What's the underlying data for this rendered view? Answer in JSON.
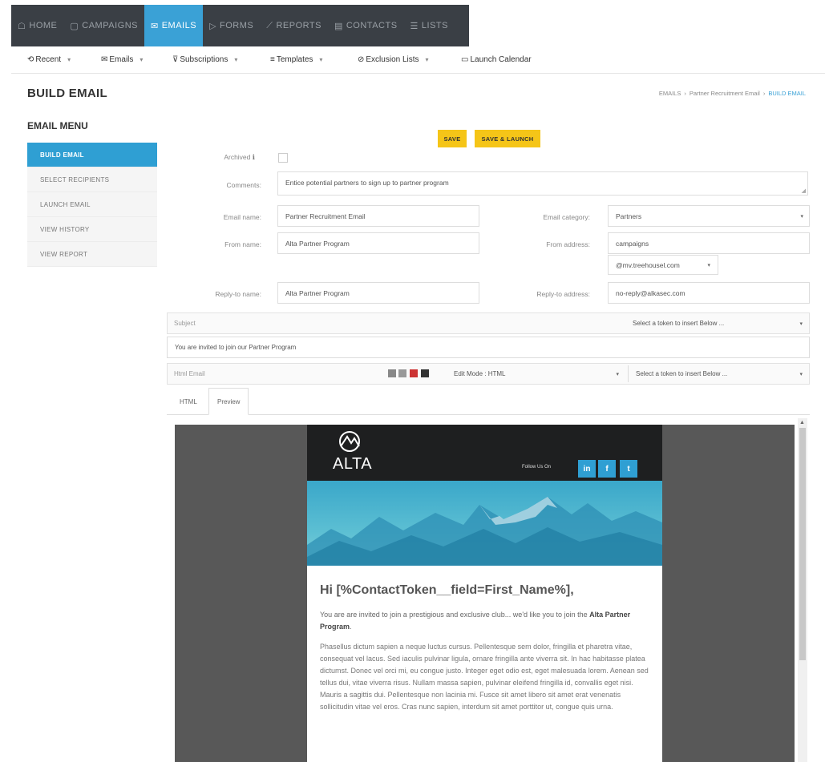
{
  "topnav": [
    {
      "icon": "☖",
      "label": "HOME",
      "active": false
    },
    {
      "icon": "▢",
      "label": "CAMPAIGNS",
      "active": false
    },
    {
      "icon": "✉",
      "label": "EMAILS",
      "active": true
    },
    {
      "icon": "▷",
      "label": "FORMS",
      "active": false
    },
    {
      "icon": "⟋",
      "label": "REPORTS",
      "active": false
    },
    {
      "icon": "▤",
      "label": "CONTACTS",
      "active": false
    },
    {
      "icon": "☰",
      "label": "LISTS",
      "active": false
    }
  ],
  "subnav": [
    {
      "icon": "⟲",
      "label": "Recent",
      "caret": true
    },
    {
      "icon": "✉",
      "label": "Emails",
      "caret": true
    },
    {
      "icon": "⊽",
      "label": "Subscriptions",
      "caret": true
    },
    {
      "icon": "≡",
      "label": "Templates",
      "caret": true
    },
    {
      "icon": "⊘",
      "label": "Exclusion Lists",
      "caret": true
    },
    {
      "icon": "▭",
      "label": "Launch Calendar",
      "caret": false
    }
  ],
  "page": {
    "title": "BUILD EMAIL",
    "breadcrumb": [
      "EMAILS",
      "Partner Recruitment Email",
      "BUILD EMAIL"
    ],
    "menu_title": "EMAIL MENU"
  },
  "sidemenu": [
    {
      "label": "BUILD EMAIL",
      "active": true
    },
    {
      "label": "SELECT RECIPIENTS",
      "active": false
    },
    {
      "label": "LAUNCH EMAIL",
      "active": false
    },
    {
      "label": "VIEW HISTORY",
      "active": false
    },
    {
      "label": "VIEW REPORT",
      "active": false
    }
  ],
  "buttons": {
    "save": "SAVE",
    "save_launch": "SAVE & LAUNCH"
  },
  "form": {
    "archived_label": "Archived",
    "comments_label": "Comments:",
    "comments_value": "Entice potential partners to sign up to partner program",
    "email_name_label": "Email name:",
    "email_name_value": "Partner Recruitment Email",
    "email_category_label": "Email category:",
    "email_category_value": "Partners",
    "from_name_label": "From name:",
    "from_name_value": "Alta Partner Program",
    "from_address_label": "From address:",
    "from_address_value": "campaigns",
    "from_domain_value": "@mv.treehousel.com",
    "reply_to_name_label": "Reply-to name:",
    "reply_to_name_value": "Alta Partner Program",
    "reply_to_address_label": "Reply-to address:",
    "reply_to_address_value": "no-reply@alkasec.com"
  },
  "subject": {
    "label": "Subject",
    "token_placeholder": "Select a token to insert Below ...",
    "value": "You are invited to join our Partner Program"
  },
  "html_email": {
    "label": "Html Email",
    "edit_mode": "Edit Mode : HTML",
    "token_placeholder": "Select a token to insert Below ...",
    "tabs": [
      "HTML",
      "Preview"
    ]
  },
  "email_preview": {
    "logo_text": "ALTA",
    "follow": "Follow Us On",
    "social": [
      "in",
      "f",
      "t"
    ],
    "greeting": "Hi [%ContactToken__field=First_Name%],",
    "intro_pre": "You are are invited to join a prestigious and exclusive club... we'd like you to join the ",
    "intro_bold": "Alta Partner Program",
    "intro_post": ".",
    "body": "Phasellus dictum sapien a neque luctus cursus. Pellentesque sem dolor, fringilla et pharetra vitae, consequat vel lacus. Sed iaculis pulvinar ligula, ornare fringilla ante viverra sit. In hac habitasse platea dictumst. Donec vel orci mi, eu congue justo. Integer eget odio est, eget malesuada lorem. Aenean sed tellus dui, vitae viverra risus. Nullam massa sapien, pulvinar eleifend fringilla id, convallis eget nisi. Mauris a sagittis dui. Pellentesque non lacinia mi. Fusce sit amet libero sit amet erat venenatis sollicitudin vitae vel eros. Cras nunc sapien, interdum sit amet porttitor ut, congue quis urna."
  },
  "colors": {
    "nav_bg": "#3a3f45",
    "accent": "#2f9fd3",
    "button": "#f5c518"
  }
}
